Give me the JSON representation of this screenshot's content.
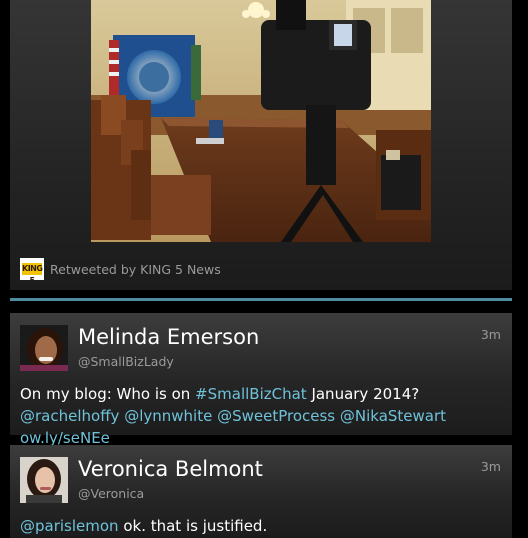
{
  "retweet": {
    "logo_text": "KING 5",
    "label": "Retweeted by KING 5 News"
  },
  "tweets": [
    {
      "display_name": "Melinda Emerson",
      "handle": "@SmallBizLady",
      "time": "3m",
      "body": {
        "t1": "On my blog: Who is on ",
        "hashtag": "#SmallBizChat",
        "t2": " January 2014? ",
        "m1": "@rachelhoffy",
        "m2": "@lynnwhite",
        "m3": "@SweetProcess",
        "m4": "@NikaStewart",
        "url": "ow.ly/seNEe"
      }
    },
    {
      "display_name": "Veronica Belmont",
      "handle": "@Veronica",
      "time": "3m",
      "body": {
        "m1": "@parislemon",
        "t1": " ok. that is justified."
      }
    }
  ],
  "colors": {
    "link": "#6fc2da",
    "divider": "#4f8ca0",
    "text_secondary": "#9a9a9a"
  },
  "icons": {
    "retweet_logo": "king5-logo",
    "avatar_1": "avatar",
    "avatar_2": "avatar"
  }
}
